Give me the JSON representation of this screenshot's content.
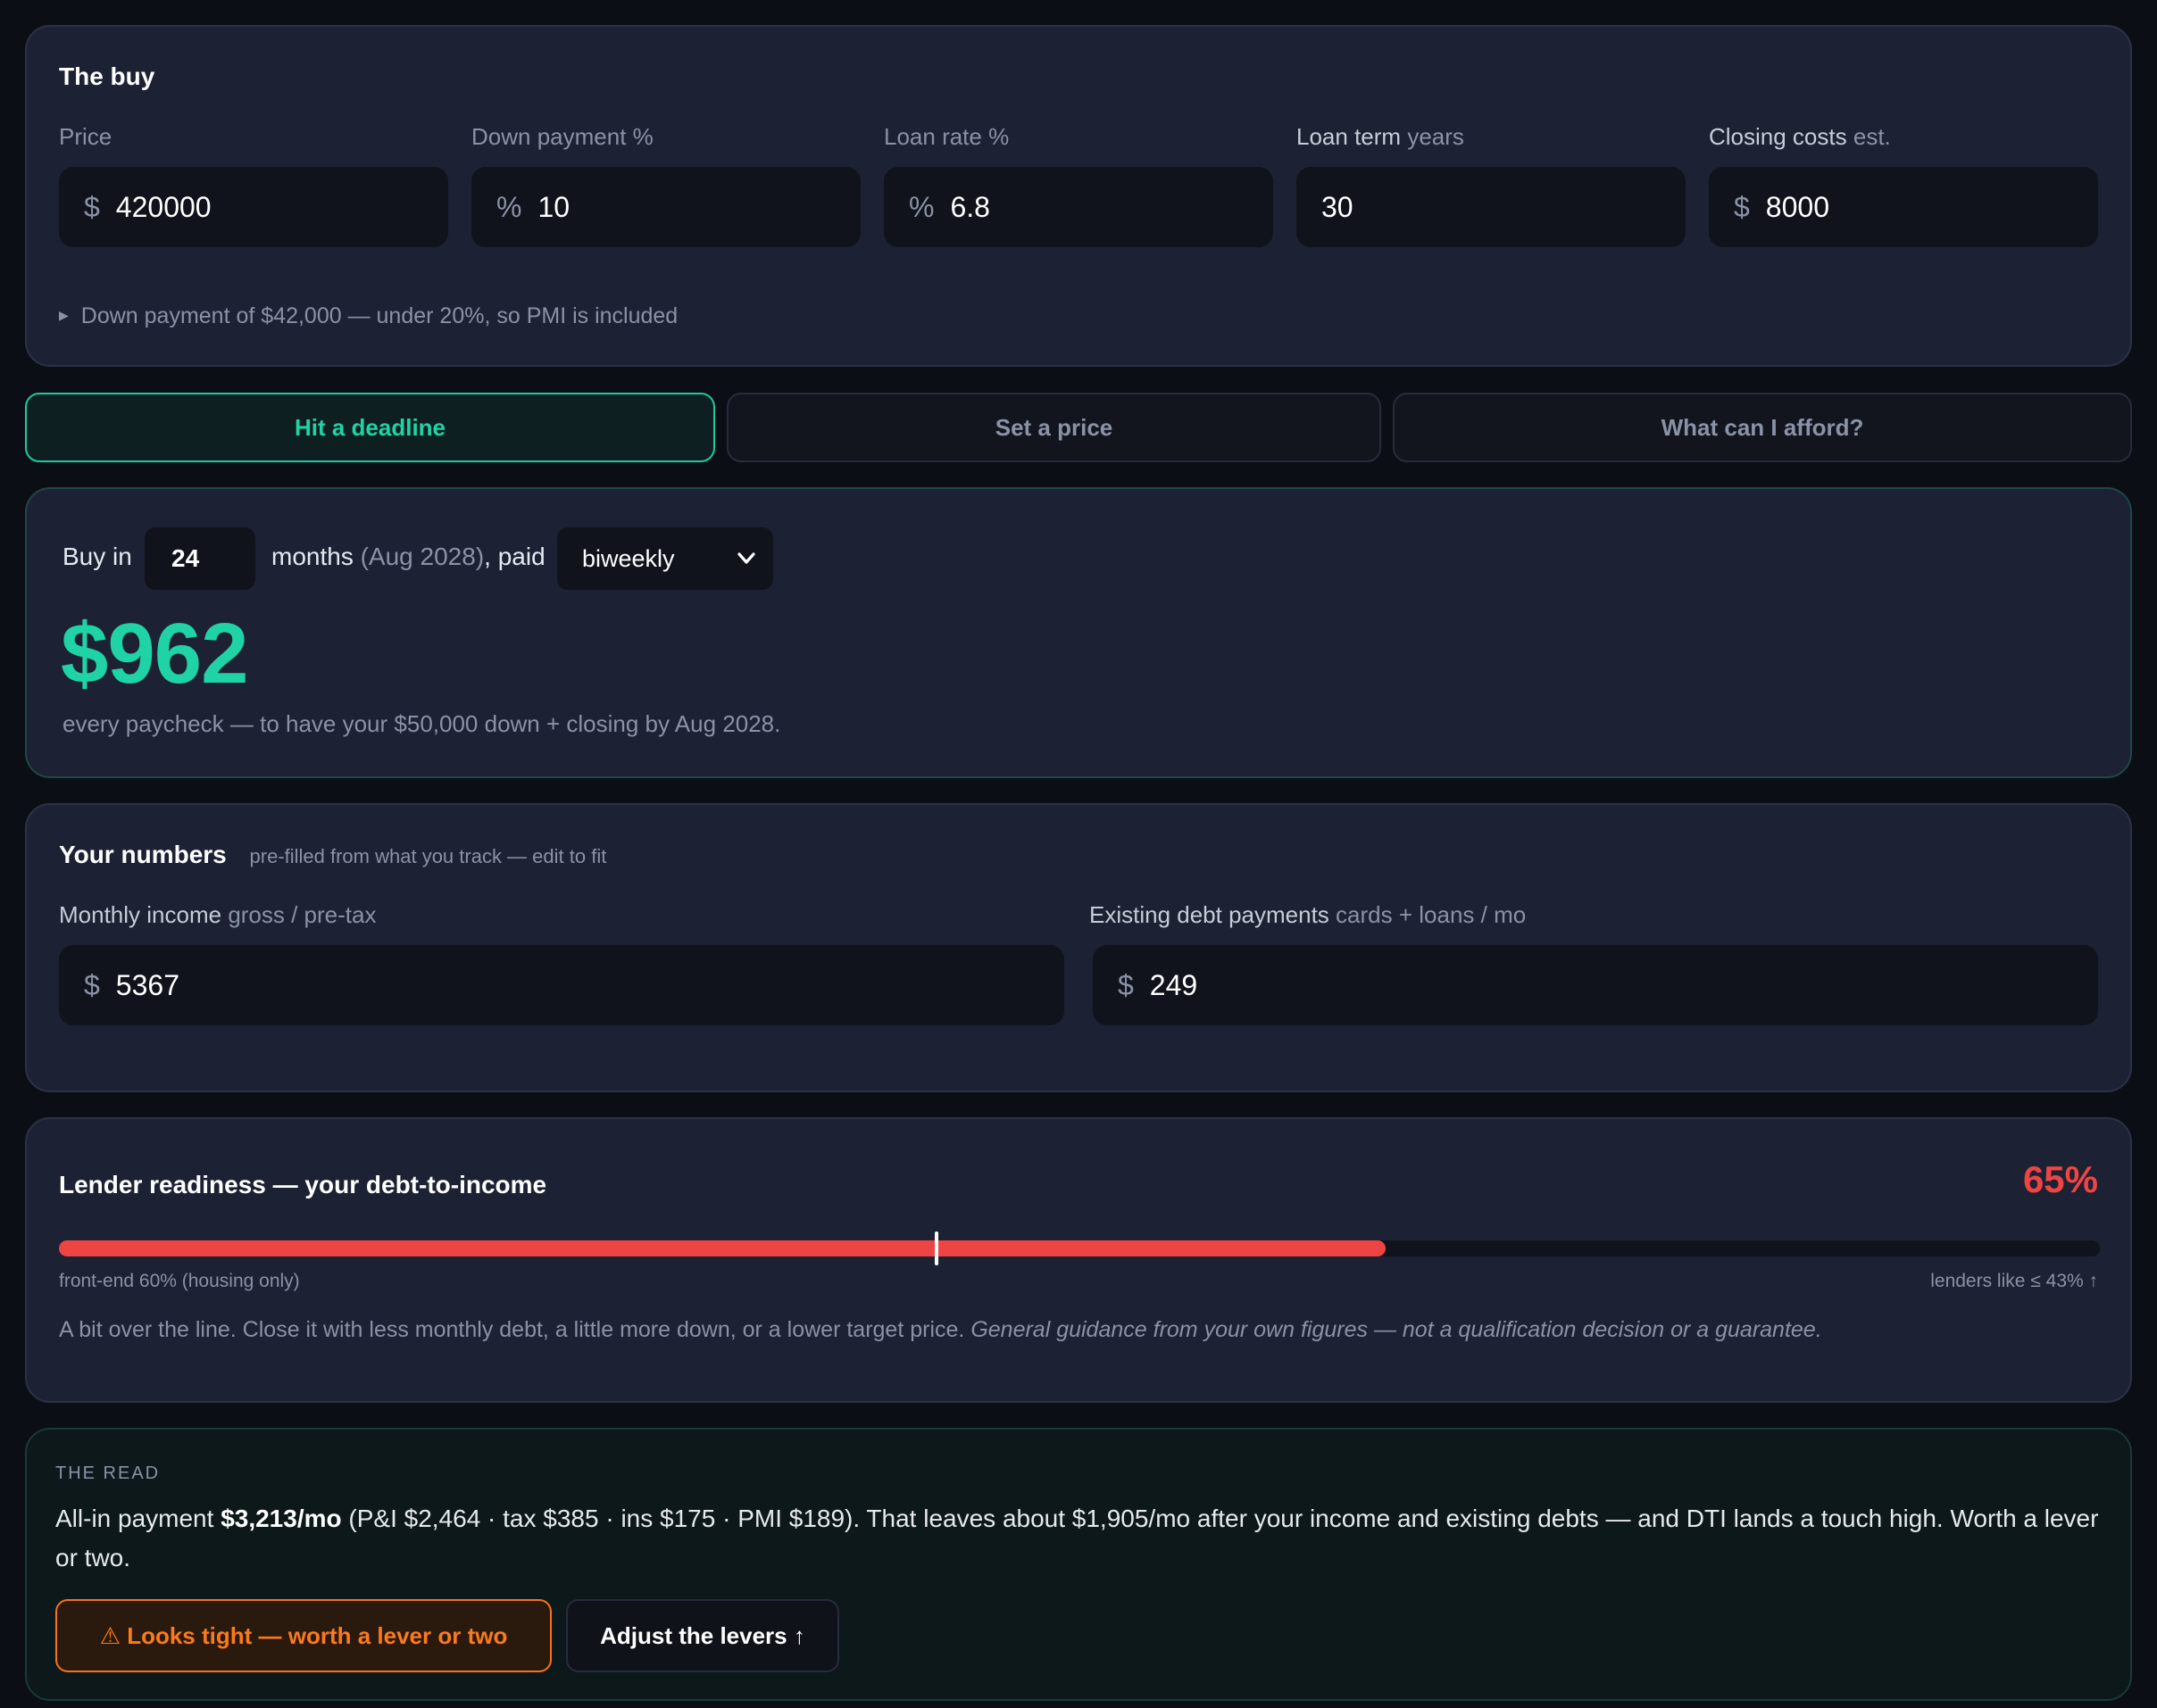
{
  "buy": {
    "title": "The buy",
    "fields": [
      {
        "label": "Price",
        "suffix": "",
        "prefix": "$",
        "value": "420000"
      },
      {
        "label": "Down payment %",
        "suffix": "",
        "prefix": "%",
        "value": "10"
      },
      {
        "label": "Loan rate %",
        "suffix": "",
        "prefix": "%",
        "value": "6.8"
      },
      {
        "label": "Loan term",
        "suffix": "years",
        "prefix": "",
        "value": "30"
      },
      {
        "label": "Closing costs",
        "suffix": "est.",
        "prefix": "$",
        "value": "8000"
      }
    ],
    "note": "Down payment of $42,000 — under 20%, so PMI is included"
  },
  "tabs": [
    {
      "label": "Hit a deadline",
      "active": true
    },
    {
      "label": "Set a price",
      "active": false
    },
    {
      "label": "What can I afford?",
      "active": false
    }
  ],
  "deadline": {
    "buy_in": "Buy in",
    "months_value": "24",
    "months": "months",
    "date_paren": "(Aug 2028)",
    "paid": ", paid",
    "frequency": "biweekly",
    "amount": "$962",
    "caption": "every paycheck — to have your $50,000 down + closing by Aug 2028."
  },
  "numbers": {
    "title": "Your numbers",
    "subtitle": "pre-filled from what you track — edit to fit",
    "income_label": "Monthly income",
    "income_hint": "gross / pre-tax",
    "income_prefix": "$",
    "income_value": "5367",
    "debt_label": "Existing debt payments",
    "debt_hint": "cards + loans / mo",
    "debt_prefix": "$",
    "debt_value": "249"
  },
  "lender": {
    "title": "Lender readiness — your debt-to-income",
    "percent": "65%",
    "dti_fraction": 0.65,
    "front_end_fraction": 0.43,
    "front_end_label": "front-end 60% (housing only)",
    "limit_label": "lenders like ≤ 43% ↑",
    "guidance": "A bit over the line. Close it with less monthly debt, a little more down, or a lower target price.",
    "disclaimer": "General guidance from your own figures — not a qualification decision or a guarantee.",
    "color": "#ef4444"
  },
  "read": {
    "eyebrow": "THE READ",
    "lead": "All-in payment ",
    "payment": "$3,213/mo",
    "body": " (P&I $2,464 · tax $385 · ins $175 · PMI $189). That leaves about $1,905/mo after your income and existing debts — and DTI lands a touch high. Worth a lever or two.",
    "warn_button": "⚠ Looks tight — worth a lever or two",
    "adjust_button": "Adjust the levers ↑"
  },
  "colors": {
    "accent": "#1fd3a6",
    "danger": "#ef4444",
    "warn": "#f97316"
  }
}
